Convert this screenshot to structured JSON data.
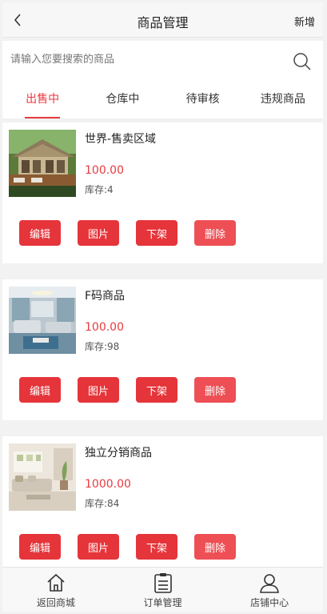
{
  "header": {
    "title": "商品管理",
    "right_action": "新增"
  },
  "search": {
    "placeholder": "请输入您要搜索的商品",
    "value": ""
  },
  "tabs": [
    {
      "label": "出售中",
      "active": true
    },
    {
      "label": "仓库中",
      "active": false
    },
    {
      "label": "待审核",
      "active": false
    },
    {
      "label": "违规商品",
      "active": false
    }
  ],
  "products": [
    {
      "name": "世界-售卖区域",
      "price": "100.00",
      "stock": "库存:4",
      "image": "pavilion-photo",
      "actions": {
        "edit": "编辑",
        "images": "图片",
        "offline": "下架",
        "delete": "删除"
      }
    },
    {
      "name": "F码商品",
      "price": "100.00",
      "stock": "库存:98",
      "image": "living-room-blue-photo",
      "actions": {
        "edit": "编辑",
        "images": "图片",
        "offline": "下架",
        "delete": "删除"
      }
    },
    {
      "name": "独立分销商品",
      "price": "1000.00",
      "stock": "库存:84",
      "image": "living-room-light-photo",
      "actions": {
        "edit": "编辑",
        "images": "图片",
        "offline": "下架",
        "delete": "删除"
      }
    }
  ],
  "tabbar": [
    {
      "label": "返回商城",
      "icon": "home-icon"
    },
    {
      "label": "订单管理",
      "icon": "clipboard-icon"
    },
    {
      "label": "店铺中心",
      "icon": "user-icon"
    }
  ],
  "colors": {
    "accent": "#e83a3f",
    "button": "#e5353b",
    "background": "#f2f2f2"
  }
}
